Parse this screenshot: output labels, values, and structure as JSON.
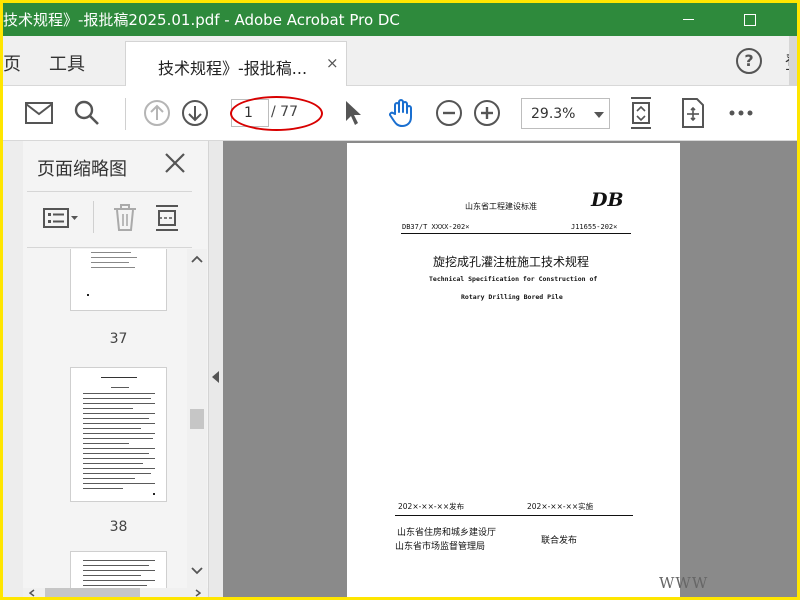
{
  "window": {
    "title": "技术规程》-报批稿2025.01.pdf - Adobe Acrobat Pro DC"
  },
  "menubar": {
    "home_label": "页",
    "tools_label": "工具",
    "tab_label": "技术规程》-报批稿...",
    "tab_close": "×",
    "help_label": "?",
    "signin_label": "登"
  },
  "toolbar": {
    "current_page": "1",
    "total_pages": "/ 77",
    "zoom": "29.3%",
    "icons": [
      "mail-icon",
      "search-icon",
      "page-up-icon",
      "page-down-icon",
      "select-arrow-icon",
      "hand-icon",
      "zoom-out-icon",
      "zoom-in-icon",
      "fit-page-icon",
      "rotate-icon",
      "more-icon"
    ]
  },
  "annotation_color": "#d80000",
  "panel": {
    "title": "页面缩略图",
    "thumbnails": [
      {
        "label": "37"
      },
      {
        "label": "38"
      },
      {
        "label": ""
      }
    ]
  },
  "document": {
    "header": "山东省工程建设标准",
    "logo": "DB",
    "std_no_left": "DB37/T XXXX-202×",
    "std_no_right": "J11655-202×",
    "title_cn": "旋挖成孔灌注桩施工技术规程",
    "title_en_1": "Technical Specification for Construction of",
    "title_en_2": "Rotary Drilling Bored Pile",
    "release_date": "202×-××-××发布",
    "implement_date": "202×-××-××实施",
    "issuer_1": "山东省住房和城乡建设厅",
    "issuer_2": "山东省市场监督管理局",
    "joint_release": "联合发布"
  },
  "watermark": "WWW"
}
